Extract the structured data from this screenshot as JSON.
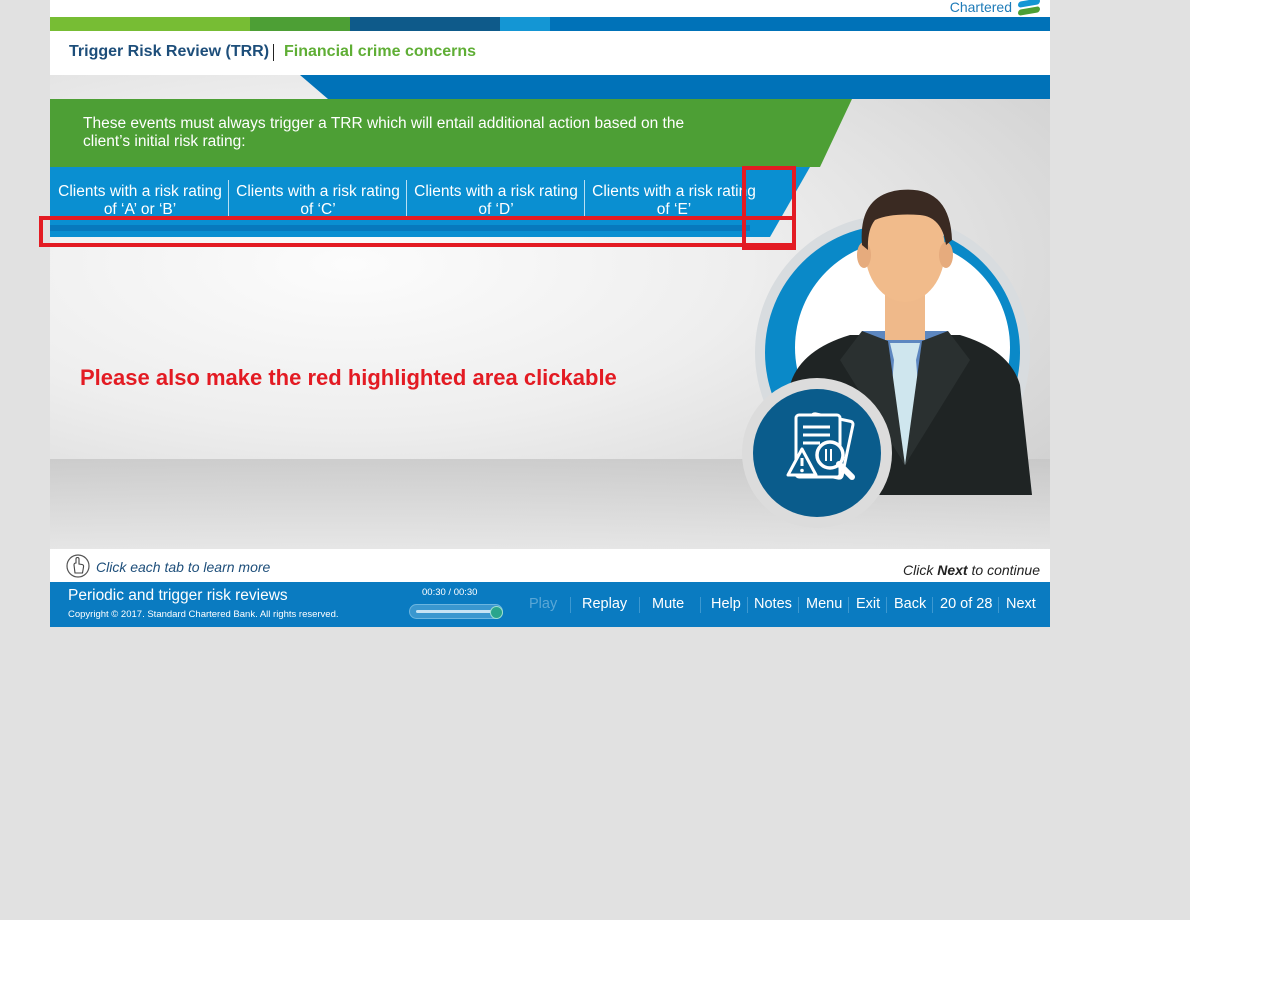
{
  "brand": {
    "name": "Chartered"
  },
  "colors": {
    "green": "#77bd34",
    "dark_green": "#4d9f35",
    "navy": "#0e5a8a",
    "cyan": "#1496d4",
    "blue": "#0072b8",
    "highlight_red": "#e31b23"
  },
  "header": {
    "title": "Trigger Risk Review (TRR)",
    "subtitle": "Financial crime concerns"
  },
  "banner": {
    "text": "These events must always trigger a TRR which will entail additional action based on the client’s initial risk rating:"
  },
  "tabs": [
    {
      "label": "Clients with a risk rating of ‘A’ or ‘B’"
    },
    {
      "label": "Clients with a risk rating of ‘C’"
    },
    {
      "label": "Clients with a risk rating of ‘D’"
    },
    {
      "label": "Clients with a risk rating of ‘E’"
    }
  ],
  "annotation": {
    "text": "Please also make the red highlighted area clickable"
  },
  "icons": {
    "hand": "hand-pointer-icon",
    "document": "document-search-warning-icon",
    "person": "businessman-illustration"
  },
  "subbar": {
    "tip": "Click each tab to learn more",
    "next_prefix": "Click ",
    "next_bold": "Next",
    "next_suffix": " to continue"
  },
  "footer": {
    "course_name": "Periodic and trigger risk reviews",
    "copyright": "Copyright © 2017. Standard Chartered Bank. All rights reserved.",
    "timer": "00:30 / 00:30",
    "progress": 1.0,
    "nav": {
      "play": "Play",
      "replay": "Replay",
      "mute": "Mute",
      "help": "Help",
      "notes": "Notes",
      "menu": "Menu",
      "exit": "Exit",
      "back": "Back",
      "page": "20 of 28",
      "next": "Next"
    }
  }
}
